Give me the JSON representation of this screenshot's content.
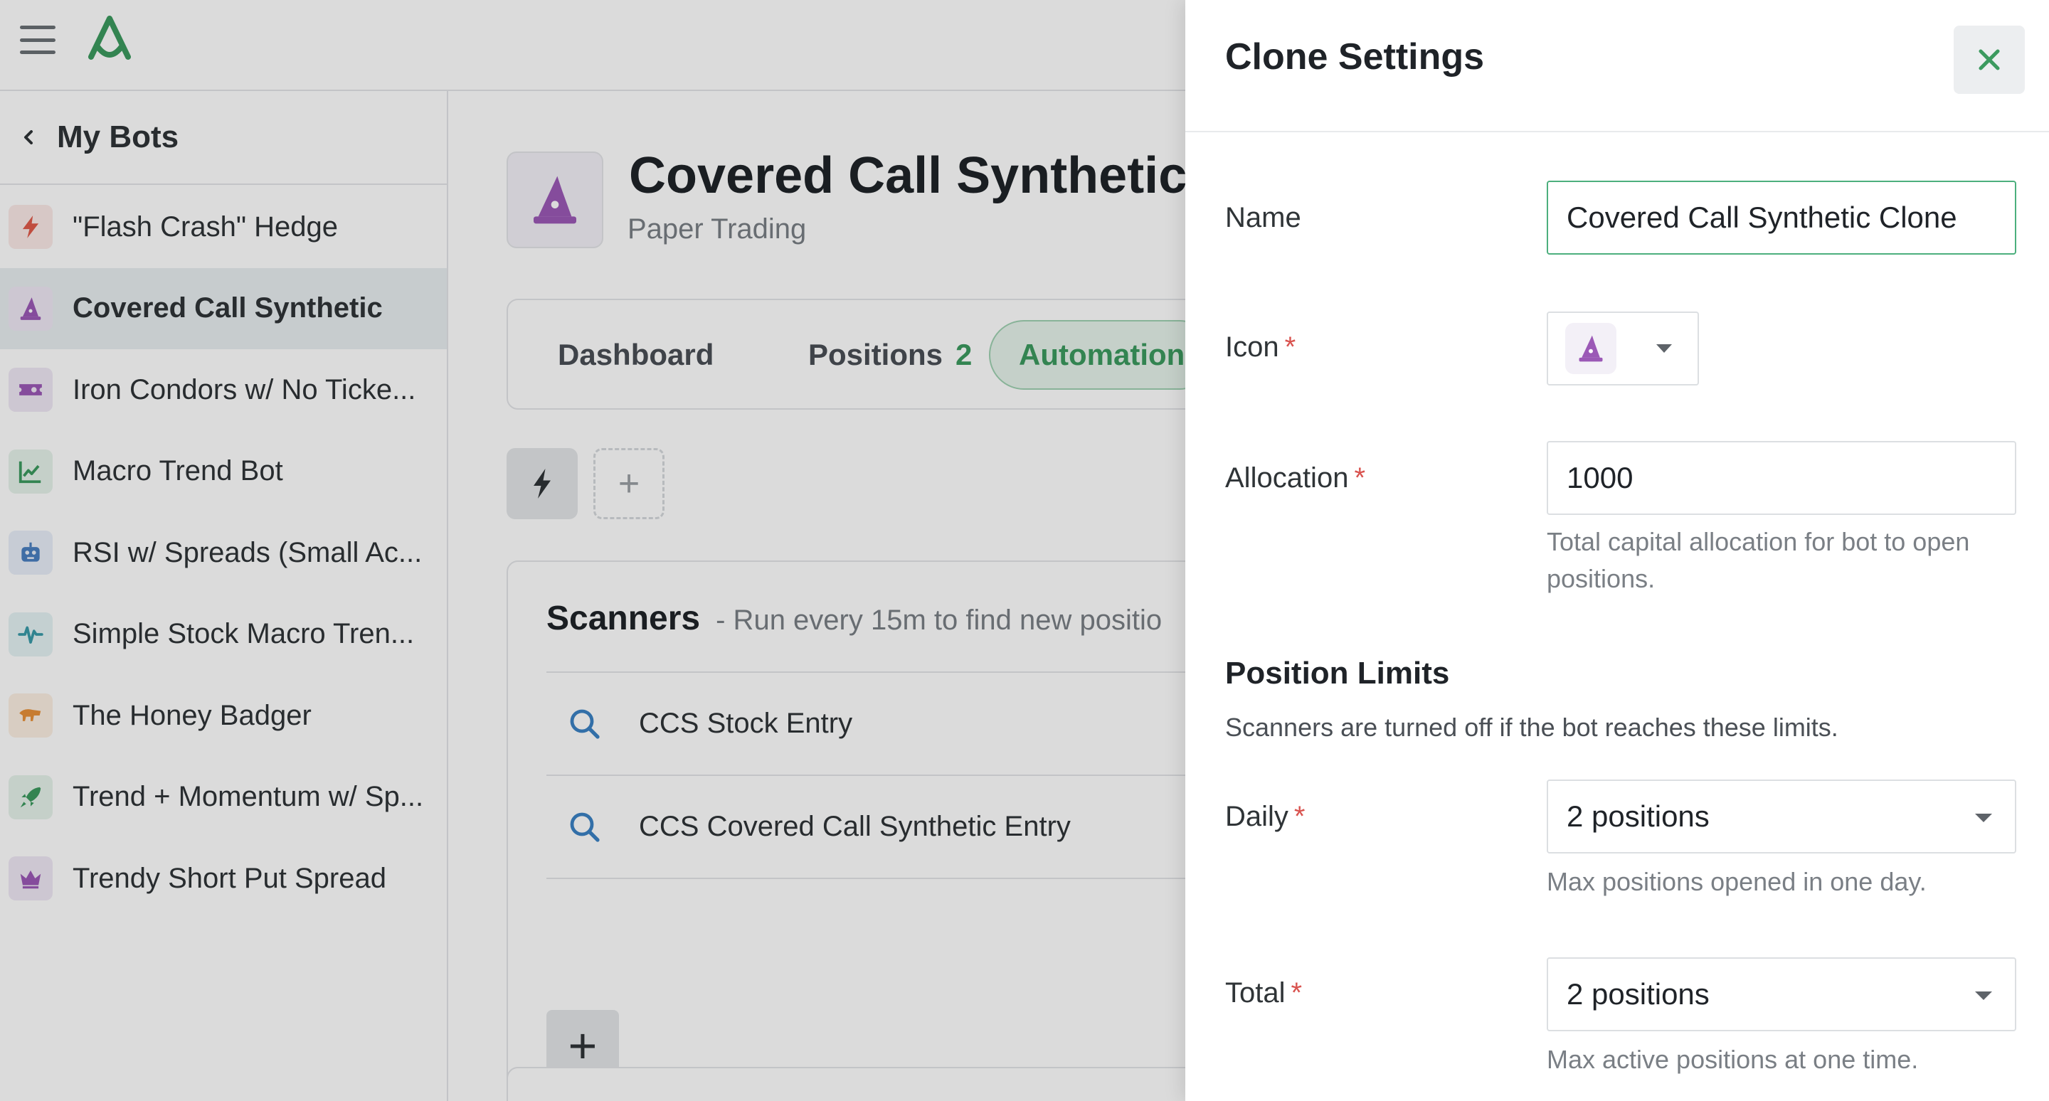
{
  "colors": {
    "brand_green": "#3c9a5f",
    "required_star": "#d9534f",
    "active_bot_bg": "#e8eef0",
    "focus_border": "#4caf7d"
  },
  "sidebar": {
    "back_label": "My Bots",
    "items": [
      {
        "label": "\"Flash Crash\" Hedge",
        "icon": "bolt-icon",
        "color": "#e05a4a"
      },
      {
        "label": "Covered Call Synthetic",
        "icon": "wizard-hat-icon",
        "color": "#9b59b6"
      },
      {
        "label": "Iron Condors w/ No Ticke...",
        "icon": "ticket-icon",
        "color": "#9b59b6"
      },
      {
        "label": "Macro Trend Bot",
        "icon": "chart-line-icon",
        "color": "#3c9a5f"
      },
      {
        "label": "RSI w/ Spreads (Small Ac...",
        "icon": "robot-icon",
        "color": "#4a7fc1"
      },
      {
        "label": "Simple Stock Macro Tren...",
        "icon": "pulse-icon",
        "color": "#3a9aa8"
      },
      {
        "label": "The Honey Badger",
        "icon": "badger-icon",
        "color": "#e8913a"
      },
      {
        "label": "Trend + Momentum w/ Sp...",
        "icon": "rocket-icon",
        "color": "#3c9a5f"
      },
      {
        "label": "Trendy Short Put Spread",
        "icon": "crown-icon",
        "color": "#9b59b6"
      }
    ]
  },
  "bot": {
    "title": "Covered Call Synthetic",
    "subtitle": "Paper Trading"
  },
  "tabs": {
    "dashboard": "Dashboard",
    "positions": "Positions",
    "positions_count": "2",
    "automation": "Automation"
  },
  "scanners": {
    "title": "Scanners",
    "description": "- Run every 15m to find new positio",
    "items": [
      {
        "label": "CCS Stock Entry"
      },
      {
        "label": "CCS Covered Call Synthetic Entry"
      }
    ]
  },
  "drawer": {
    "title": "Clone Settings",
    "name_label": "Name",
    "name_value": "Covered Call Synthetic Clone",
    "icon_label": "Icon",
    "allocation_label": "Allocation",
    "allocation_value": "1000",
    "allocation_help": "Total capital allocation for bot to open positions.",
    "limits_title": "Position Limits",
    "limits_desc": "Scanners are turned off if the bot reaches these limits.",
    "daily_label": "Daily",
    "daily_value": "2 positions",
    "daily_help": "Max positions opened in one day.",
    "total_label": "Total",
    "total_value": "2 positions",
    "total_help": "Max active positions at one time.",
    "required_mark": "*"
  }
}
